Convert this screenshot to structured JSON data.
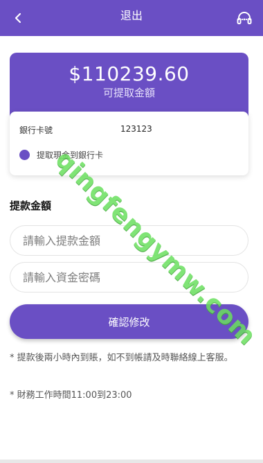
{
  "header": {
    "title": "退出",
    "back_icon": "chevron-left-icon",
    "service_icon": "headset-icon"
  },
  "balance": {
    "amount": "$110239.60",
    "label": "可提取金額"
  },
  "bank": {
    "card_label": "銀行卡號",
    "card_value": "123123",
    "option_label": "提取現金到銀行卡"
  },
  "form": {
    "section_title": "提款金額",
    "amount_placeholder": "請輸入提款金額",
    "password_placeholder": "請輸入資金密碼",
    "confirm_label": "確認修改"
  },
  "notes": {
    "note1": "* 提款後兩小時內到賬，如不到帳請及時聯絡線上客服。",
    "note2": "* 財務工作時間11:00到23:00"
  },
  "watermark": "qingfengymw.com",
  "colors": {
    "primary": "#6a4fc4",
    "watermark": "#6be05f"
  }
}
